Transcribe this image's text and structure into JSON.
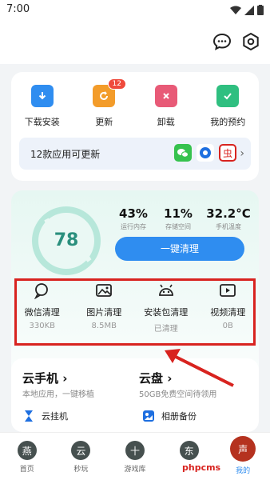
{
  "status_bar": {
    "time": "7:00"
  },
  "top_actions": [
    {
      "name": "message",
      "icon": "chat-bubble-icon"
    },
    {
      "name": "settings",
      "icon": "gear-hex-icon"
    }
  ],
  "quick_actions": [
    {
      "label": "下载安装",
      "icon": "download-folder-icon",
      "color": "#2f8df0"
    },
    {
      "label": "更新",
      "icon": "update-icon",
      "color": "#f39c2a",
      "badge": "12"
    },
    {
      "label": "卸载",
      "icon": "trash-icon",
      "color": "#e85a77"
    },
    {
      "label": "我的预约",
      "icon": "calendar-check-icon",
      "color": "#2fbf80"
    }
  ],
  "updates_bar": {
    "text": "12款应用可更新"
  },
  "device_status": {
    "score": "78",
    "metrics": [
      {
        "value": "43%",
        "label": "运行内存"
      },
      {
        "value": "11%",
        "label": "存储空间"
      },
      {
        "value": "32.2°C",
        "label": "手机温度"
      }
    ],
    "clean_button": "一键清理"
  },
  "clean_items": [
    {
      "label": "微信清理",
      "sub": "330KB",
      "icon": "wechat-bubble-icon"
    },
    {
      "label": "图片清理",
      "sub": "8.5MB",
      "icon": "image-icon"
    },
    {
      "label": "安装包清理",
      "sub": "已清理",
      "icon": "android-icon"
    },
    {
      "label": "视频清理",
      "sub": "0B",
      "icon": "video-play-icon"
    }
  ],
  "cloud": {
    "phone_title": "云手机 ›",
    "phone_sub": "本地应用，一键移植",
    "phone_feature": "云挂机",
    "disk_title": "云盘 ›",
    "disk_sub": "50GB免费空间待领用",
    "disk_feature": "相册备份"
  },
  "tabs": [
    {
      "label": "首页",
      "glyph": "燕"
    },
    {
      "label": "秒玩",
      "glyph": "云"
    },
    {
      "label": "游戏库",
      "glyph": "十"
    },
    {
      "label": "",
      "glyph": "东"
    },
    {
      "label": "我的",
      "glyph": "声",
      "active": true
    }
  ],
  "watermark": "phpcms"
}
